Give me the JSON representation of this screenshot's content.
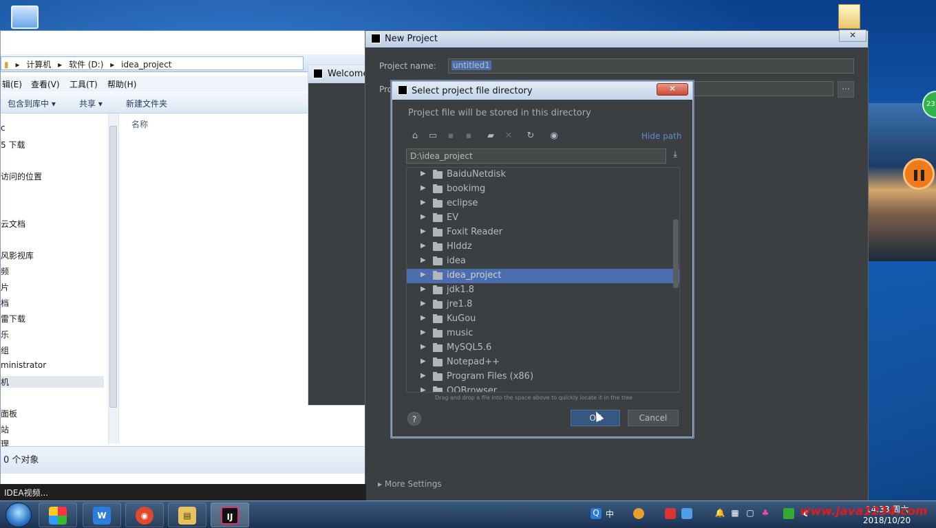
{
  "explorer": {
    "address_parts": [
      "计算机",
      "软件 (D:)",
      "idea_project"
    ],
    "menu": [
      "辑(E)",
      "查看(V)",
      "工具(T)",
      "帮助(H)"
    ],
    "toolbar": [
      "包含到库中 ▾",
      "共享 ▾",
      "新建文件夹"
    ],
    "nav_items": [
      "c",
      "5 下载",
      "访问的位置",
      "云文档",
      "风影视库",
      "频",
      "片",
      "档",
      "雷下载",
      "乐",
      "组",
      "ministrator",
      "机",
      "面板",
      "站",
      "理"
    ],
    "column_header": "名称",
    "status": "0 个对象"
  },
  "welcome": {
    "title": "Welcome"
  },
  "new_project": {
    "title": "New Project",
    "close": "✕",
    "project_name_label": "Project name:",
    "project_name_value": "untitled1",
    "project_location_label": "Pro",
    "browse": "...",
    "more_settings": "More Settings"
  },
  "select_dir": {
    "title": "Select project file directory",
    "close": "✕",
    "description": "Project file will be stored in this directory",
    "hide_path": "Hide path",
    "path": "D:\\idea_project",
    "tree": [
      "BaiduNetdisk",
      "bookimg",
      "eclipse",
      "EV",
      "Foxit Reader",
      "Hlddz",
      "idea",
      "idea_project",
      "jdk1.8",
      "jre1.8",
      "KuGou",
      "music",
      "MySQL5.6",
      "Notepad++",
      "Program Files (x86)",
      "QQBrowser"
    ],
    "selected": "idea_project",
    "hint": "Drag and drop a file into the space above to quickly locate it in the tree",
    "help": "?",
    "ok": "OK",
    "cancel": "Cancel"
  },
  "task_tooltip": "IDEA视频...",
  "taskbar": {
    "apps": [
      {
        "name": "wps-app",
        "glyph": "W",
        "color": "#2b7de0"
      },
      {
        "name": "chrome-app",
        "glyph": "◉",
        "color": "#e04a2b"
      },
      {
        "name": "explorer-app",
        "glyph": "▤",
        "color": "#e8c25a"
      },
      {
        "name": "idea-app",
        "glyph": "IJ",
        "color": "#d8306b"
      }
    ],
    "ime": "中",
    "time": "14:33 周六",
    "date": "2018/10/20"
  },
  "watermark": "www.java1234.com",
  "badge": "23"
}
